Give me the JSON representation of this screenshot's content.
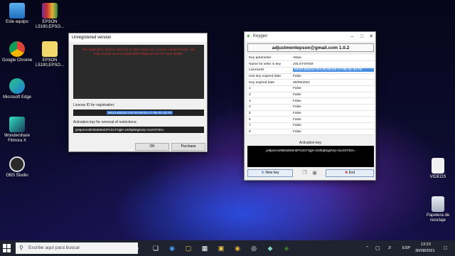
{
  "desktop": {
    "icons": [
      {
        "label": "Este equipo",
        "color": "#3b8fd9"
      },
      {
        "label": "EPSON L5190,EPSO...",
        "color": "#c8352b"
      },
      {
        "label": "Google Chrome",
        "color": "#e9b33a"
      },
      {
        "label": "EPSON L5190,EPSO...",
        "color": "#f2d86a"
      },
      {
        "label": "Microsoft Edge",
        "color": "#1f7ad6"
      },
      {
        "label": "Wondershare Filmora X",
        "color": "#2a6f7a"
      },
      {
        "label": "OBS Studio",
        "color": "#3a3a3a"
      },
      {
        "label": "VIDEOS",
        "color": "#f1f1f1"
      },
      {
        "label": "Papelera de reciclaje",
        "color": "#cfd6e0"
      }
    ]
  },
  "unregistered": {
    "title": "Unregistered version",
    "message": "The application need a valid key to start. Send your License number below. You may contact us at rocidjohn82017@gmail.com for more details.",
    "license_label": "License ID for registration:",
    "license_value": "NN10-B0D3A7D4-00-08-E0-A7-0E-91-20-F5",
    "activation_label": "Activation key for removal of restrictions:",
    "activation_value": "jxMp3Am0l0Ii0dS9mbPC5CFOjj9+240fq6lZg6Vrp+3xJOi7r5O=",
    "ok_label": "OK",
    "purchase_label": "Purchase"
  },
  "keygen": {
    "title": "Keygen",
    "header": "adjustmentepson@gmail.com 1.0.2",
    "columns": [
      "Key parameter",
      "Value"
    ],
    "rows": [
      {
        "k": "Name for write in key",
        "v": "JOLSYSTEM"
      },
      {
        "k": "LicenseID",
        "v": "NN10-B0D3A7D4-00-08-E0-A7-0E-91-20-F5"
      },
      {
        "k": "Use key expired date",
        "v": "False"
      },
      {
        "k": "Key expired date",
        "v": "30/08/2021"
      },
      {
        "k": "1",
        "v": "False"
      },
      {
        "k": "2",
        "v": "False"
      },
      {
        "k": "3",
        "v": "False"
      },
      {
        "k": "4",
        "v": "False"
      },
      {
        "k": "5",
        "v": "False"
      },
      {
        "k": "6",
        "v": "False"
      },
      {
        "k": "7",
        "v": "False"
      },
      {
        "k": "8",
        "v": "False"
      }
    ],
    "activation_caption": "Activation key:",
    "activation_value": "jxMp3Am0l0Ii0dS9mbPC5CFOjj9+240fq6lZg6Vrp+3xJOi7r5O=",
    "new_key_label": "New key",
    "exit_label": "Exit"
  },
  "taskbar": {
    "search_placeholder": "Escribe aquí para buscar",
    "lang": "ESP",
    "time": "13:23",
    "date": "30/08/2021"
  }
}
